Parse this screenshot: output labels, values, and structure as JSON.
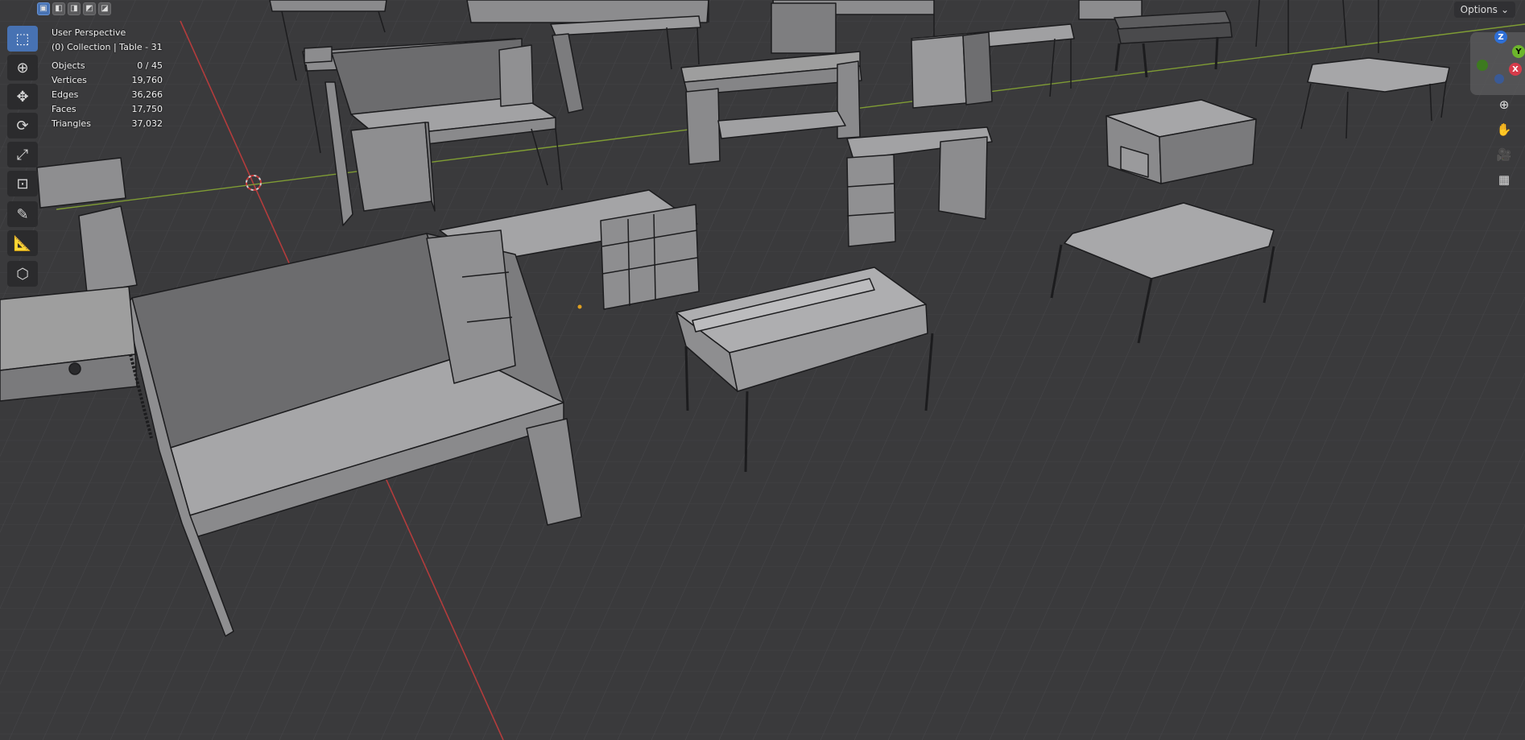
{
  "header": {
    "select_modes": [
      "new",
      "extend",
      "subtract",
      "invert",
      "intersect"
    ],
    "options_label": "Options"
  },
  "viewport": {
    "perspective_label": "User Perspective",
    "collection_label": "(0) Collection | Table - 31",
    "stats": [
      {
        "label": "Objects",
        "value": "0 / 45"
      },
      {
        "label": "Vertices",
        "value": "19,760"
      },
      {
        "label": "Edges",
        "value": "36,266"
      },
      {
        "label": "Faces",
        "value": "17,750"
      },
      {
        "label": "Triangles",
        "value": "37,032"
      }
    ]
  },
  "toolbar": {
    "tools": [
      "select-box",
      "cursor",
      "move",
      "rotate",
      "scale",
      "transform",
      "annotate",
      "measure",
      "add-cube"
    ]
  },
  "gizmo": {
    "z": "Z",
    "y": "Y",
    "x": "X"
  },
  "colors": {
    "background": "#3a3a3c",
    "grid": "#4a4a4d",
    "axis_x": "#b33c3c",
    "axis_y": "#8aa33a",
    "accent": "#4772b3",
    "furniture": "#9a9a9c",
    "edges": "#1c1c1e"
  }
}
